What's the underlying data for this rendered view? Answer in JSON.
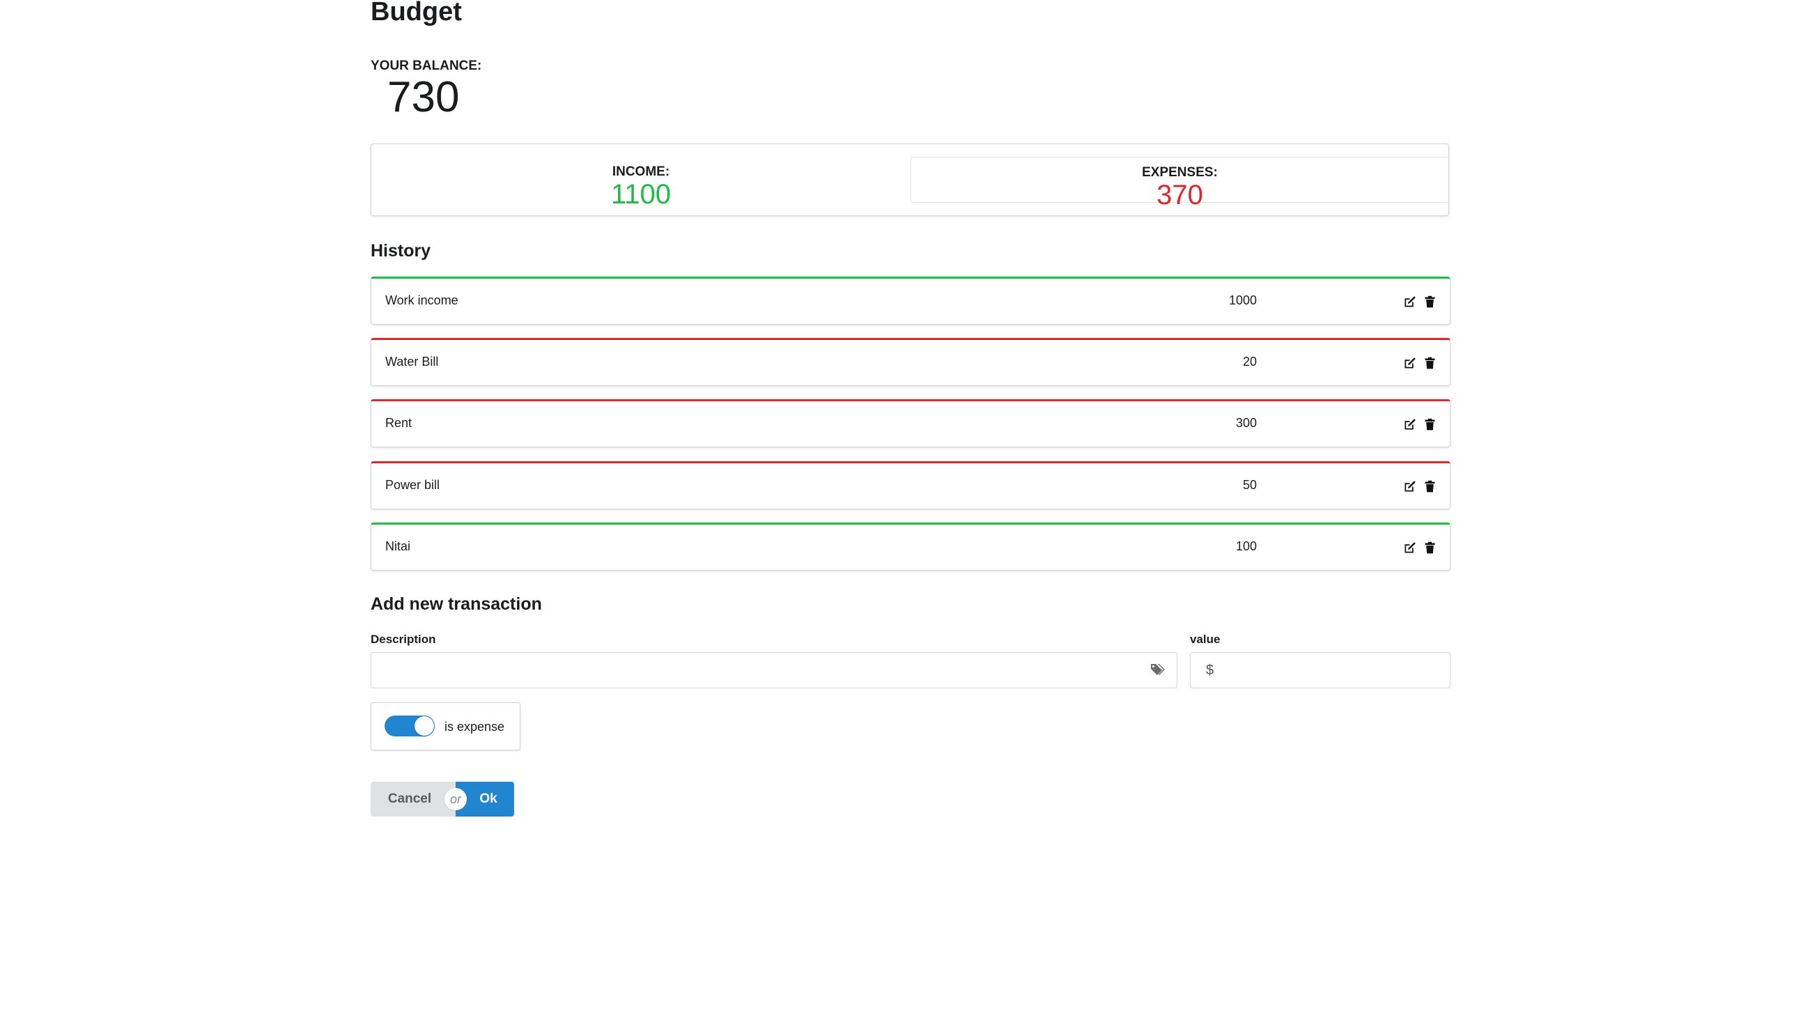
{
  "page": {
    "title": "Budget"
  },
  "balance": {
    "label": "YOUR BALANCE:",
    "value": "730"
  },
  "stats": {
    "income_label": "INCOME:",
    "income_value": "1100",
    "expenses_label": "EXPENSES:",
    "expenses_value": "370",
    "income_color": "#21ba45",
    "expense_color": "#db2828"
  },
  "history": {
    "title": "History",
    "items": [
      {
        "description": "Work income",
        "value": "1000",
        "type": "income"
      },
      {
        "description": "Water Bill",
        "value": "20",
        "type": "expense"
      },
      {
        "description": "Rent",
        "value": "300",
        "type": "expense"
      },
      {
        "description": "Power bill",
        "value": "50",
        "type": "expense"
      },
      {
        "description": "Nitai",
        "value": "100",
        "type": "income"
      }
    ],
    "edit_icon": "edit-icon",
    "delete_icon": "trash-icon"
  },
  "form": {
    "title": "Add new transaction",
    "description_label": "Description",
    "description_value": "",
    "description_icon": "tags-icon",
    "value_label": "value",
    "value_value": "",
    "currency_symbol": "$",
    "toggle_label": "is expense",
    "toggle_on": true,
    "cancel_label": "Cancel",
    "or_label": "or",
    "ok_label": "Ok",
    "accent_color": "#2185d0"
  }
}
